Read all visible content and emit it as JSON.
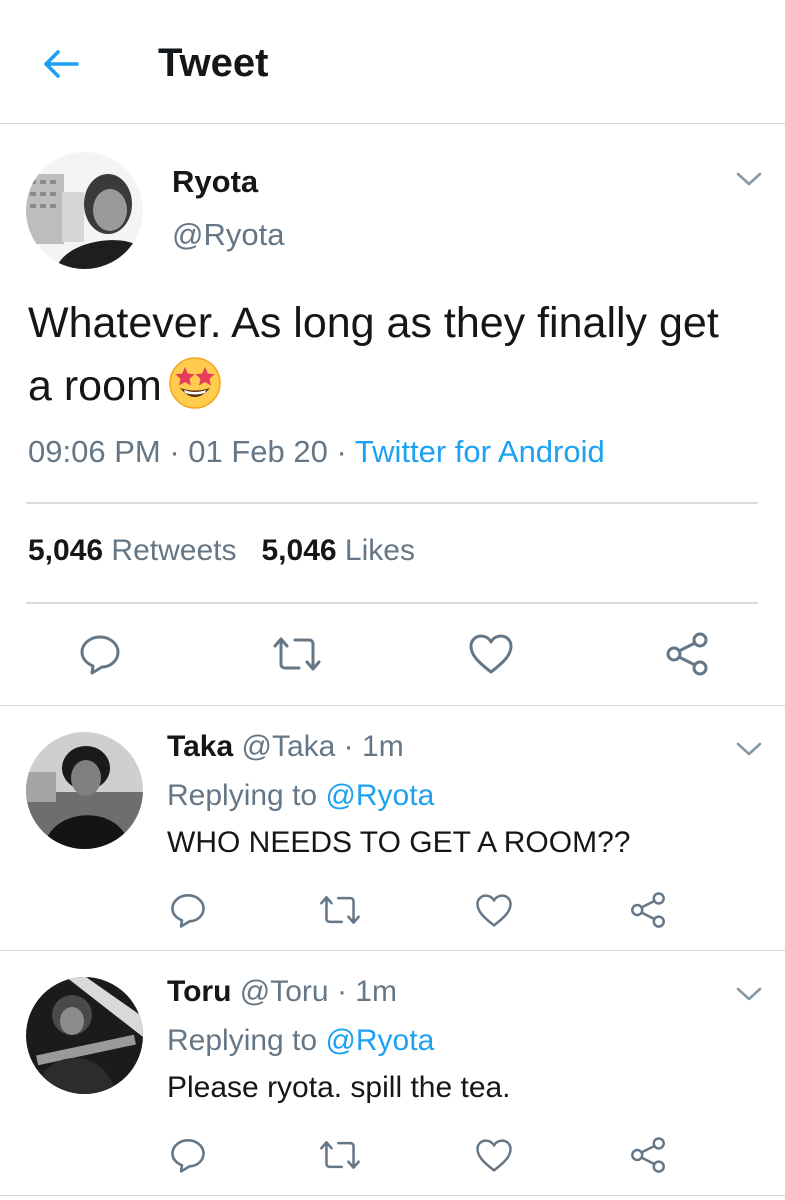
{
  "header": {
    "title": "Tweet",
    "back_icon": "arrow-left-icon",
    "accent": "#1da1f2"
  },
  "main_tweet": {
    "name": "Ryota",
    "handle": "@Ryota",
    "text": "Whatever. As long as they finally get a room",
    "emoji": "star-struck-emoji",
    "time": "09:06 PM",
    "date": "01 Feb 20",
    "sep": "·",
    "source": "Twitter for Android",
    "retweets_count": "5,046",
    "retweets_label": "Retweets",
    "likes_count": "5,046",
    "likes_label": "Likes",
    "actions": [
      "reply-icon",
      "retweet-icon",
      "like-icon",
      "share-icon"
    ]
  },
  "replies": [
    {
      "name": "Taka",
      "handle": "@Taka",
      "time": "1m",
      "sep": "·",
      "replying_label": "Replying to",
      "replying_to": "@Ryota",
      "text": "WHO NEEDS TO GET A ROOM??"
    },
    {
      "name": "Toru",
      "handle": "@Toru",
      "time": "1m",
      "sep": "·",
      "replying_label": "Replying to",
      "replying_to": "@Ryota",
      "text": "Please ryota. spill the tea."
    }
  ]
}
